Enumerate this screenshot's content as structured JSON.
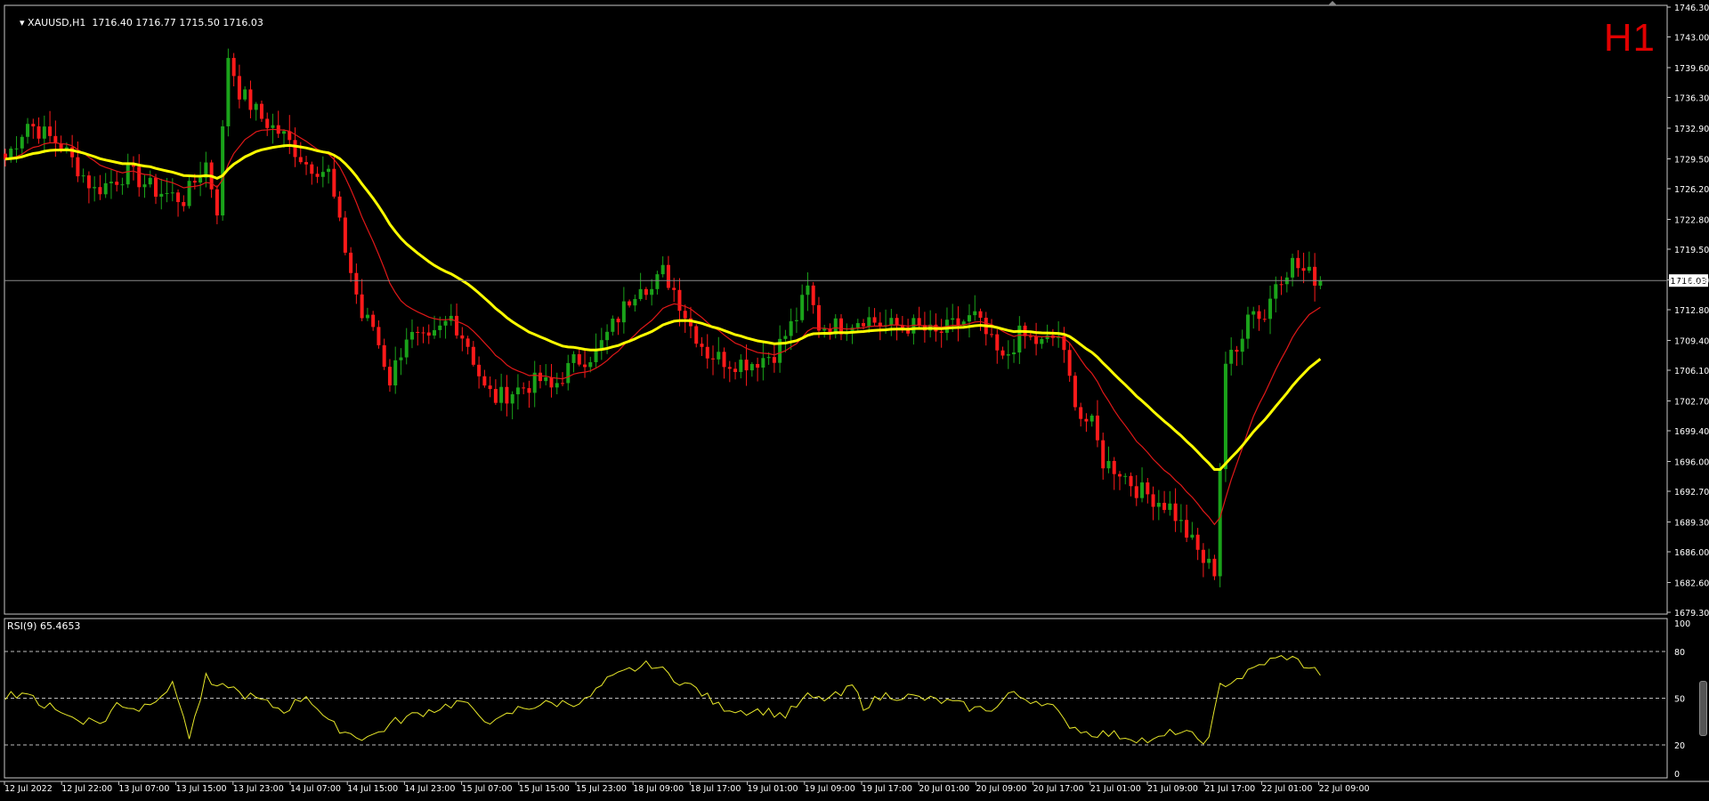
{
  "header": {
    "symbol": "XAUUSD,H1",
    "ohlc": "1716.40 1716.77 1715.50 1716.03",
    "timeframe_badge": "H1"
  },
  "rsi_panel": {
    "label": "RSI(9) 65.4653",
    "levels": [
      80,
      50,
      20
    ],
    "scale_labels": [
      "100",
      "80",
      "50",
      "20",
      "0"
    ]
  },
  "colors": {
    "background": "#000000",
    "bull": "#1aa31a",
    "bear": "#ff1a1a",
    "ma_slow": "#ffff00",
    "ma_fast": "#e01818",
    "rsi_line": "#e8e82a",
    "current_price_line": "#8a8a8a",
    "timeframe_badge": "#e10000"
  },
  "chart_data": {
    "type": "candlestick",
    "symbol": "XAUUSD",
    "timeframe": "H1",
    "price_scale": {
      "ylim": [
        1679.3,
        1746.3
      ],
      "tick_labels": [
        "1746.30",
        "1743.00",
        "1739.60",
        "1736.30",
        "1732.90",
        "1729.50",
        "1726.20",
        "1722.80",
        "1719.50",
        "1716.10",
        "1712.80",
        "1709.40",
        "1706.10",
        "1702.70",
        "1699.40",
        "1696.00",
        "1692.70",
        "1689.30",
        "1686.00",
        "1682.60",
        "1679.30"
      ]
    },
    "current_price": "1716.03",
    "x_tick_labels": [
      "12 Jul 2022",
      "12 Jul 22:00",
      "13 Jul 07:00",
      "13 Jul 15:00",
      "13 Jul 23:00",
      "14 Jul 07:00",
      "14 Jul 15:00",
      "14 Jul 23:00",
      "15 Jul 07:00",
      "15 Jul 15:00",
      "15 Jul 23:00",
      "18 Jul 09:00",
      "18 Jul 17:00",
      "19 Jul 01:00",
      "19 Jul 09:00",
      "19 Jul 17:00",
      "20 Jul 01:00",
      "20 Jul 09:00",
      "20 Jul 17:00",
      "21 Jul 01:00",
      "21 Jul 09:00",
      "21 Jul 17:00",
      "22 Jul 01:00",
      "22 Jul 09:00"
    ],
    "price_anchors": [
      [
        0,
        1729.5
      ],
      [
        4,
        1733.5
      ],
      [
        10,
        1731
      ],
      [
        16,
        1726
      ],
      [
        22,
        1728
      ],
      [
        27,
        1726
      ],
      [
        32,
        1725
      ],
      [
        36,
        1729
      ],
      [
        38,
        1724
      ],
      [
        40,
        1741
      ],
      [
        42,
        1737
      ],
      [
        46,
        1734
      ],
      [
        50,
        1732
      ],
      [
        54,
        1729
      ],
      [
        58,
        1728
      ],
      [
        60,
        1722
      ],
      [
        64,
        1712
      ],
      [
        66,
        1711
      ],
      [
        69,
        1705
      ],
      [
        72,
        1710
      ],
      [
        76,
        1709
      ],
      [
        80,
        1712
      ],
      [
        83,
        1709
      ],
      [
        86,
        1704
      ],
      [
        88,
        1703
      ],
      [
        92,
        1704
      ],
      [
        96,
        1705
      ],
      [
        98,
        1704
      ],
      [
        102,
        1707
      ],
      [
        106,
        1708
      ],
      [
        110,
        1712
      ],
      [
        114,
        1716
      ],
      [
        116,
        1715
      ],
      [
        118,
        1717
      ],
      [
        120,
        1715
      ],
      [
        123,
        1711
      ],
      [
        126,
        1708
      ],
      [
        130,
        1707
      ],
      [
        134,
        1707
      ],
      [
        138,
        1708
      ],
      [
        142,
        1712
      ],
      [
        144,
        1715
      ],
      [
        146,
        1711
      ],
      [
        150,
        1711
      ],
      [
        154,
        1712
      ],
      [
        158,
        1711
      ],
      [
        163,
        1711
      ],
      [
        167,
        1710
      ],
      [
        170,
        1711
      ],
      [
        174,
        1712
      ],
      [
        176,
        1710
      ],
      [
        179,
        1707
      ],
      [
        182,
        1710
      ],
      [
        186,
        1709
      ],
      [
        189,
        1710
      ],
      [
        191,
        1705
      ],
      [
        193,
        1701
      ],
      [
        195,
        1700
      ],
      [
        197,
        1696
      ],
      [
        200,
        1695
      ],
      [
        203,
        1693
      ],
      [
        206,
        1692
      ],
      [
        209,
        1691
      ],
      [
        212,
        1688
      ],
      [
        215,
        1685
      ],
      [
        217,
        1684
      ],
      [
        219,
        1707
      ],
      [
        221,
        1708
      ],
      [
        223,
        1713
      ],
      [
        226,
        1712
      ],
      [
        228,
        1716
      ],
      [
        231,
        1718
      ],
      [
        233,
        1717
      ],
      [
        236,
        1716
      ]
    ],
    "rsi_anchors": [
      [
        0,
        52
      ],
      [
        4,
        54
      ],
      [
        6,
        44
      ],
      [
        8,
        48
      ],
      [
        10,
        40
      ],
      [
        14,
        36
      ],
      [
        18,
        35
      ],
      [
        20,
        47
      ],
      [
        24,
        43
      ],
      [
        28,
        53
      ],
      [
        30,
        58
      ],
      [
        32,
        40
      ],
      [
        33,
        24
      ],
      [
        36,
        63
      ],
      [
        38,
        55
      ],
      [
        40,
        59
      ],
      [
        42,
        53
      ],
      [
        44,
        51
      ],
      [
        46,
        48
      ],
      [
        50,
        42
      ],
      [
        54,
        52
      ],
      [
        56,
        44
      ],
      [
        58,
        34
      ],
      [
        62,
        27
      ],
      [
        64,
        25
      ],
      [
        66,
        26
      ],
      [
        70,
        35
      ],
      [
        74,
        40
      ],
      [
        78,
        44
      ],
      [
        82,
        48
      ],
      [
        84,
        41
      ],
      [
        88,
        34
      ],
      [
        92,
        43
      ],
      [
        96,
        46
      ],
      [
        100,
        47
      ],
      [
        104,
        48
      ],
      [
        108,
        61
      ],
      [
        112,
        68
      ],
      [
        116,
        72
      ],
      [
        120,
        63
      ],
      [
        124,
        56
      ],
      [
        128,
        45
      ],
      [
        132,
        42
      ],
      [
        136,
        42
      ],
      [
        140,
        39
      ],
      [
        144,
        51
      ],
      [
        146,
        49
      ],
      [
        150,
        52
      ],
      [
        152,
        58
      ],
      [
        154,
        45
      ],
      [
        158,
        52
      ],
      [
        162,
        51
      ],
      [
        166,
        49
      ],
      [
        170,
        47
      ],
      [
        174,
        43
      ],
      [
        178,
        44
      ],
      [
        180,
        53
      ],
      [
        184,
        49
      ],
      [
        186,
        48
      ],
      [
        188,
        44
      ],
      [
        190,
        35
      ],
      [
        194,
        28
      ],
      [
        198,
        27
      ],
      [
        202,
        25
      ],
      [
        206,
        22
      ],
      [
        210,
        29
      ],
      [
        212,
        27
      ],
      [
        214,
        24
      ],
      [
        216,
        23
      ],
      [
        218,
        58
      ],
      [
        222,
        64
      ],
      [
        226,
        73
      ],
      [
        230,
        77
      ],
      [
        234,
        70
      ],
      [
        236,
        66
      ]
    ],
    "n_bars": 237
  }
}
